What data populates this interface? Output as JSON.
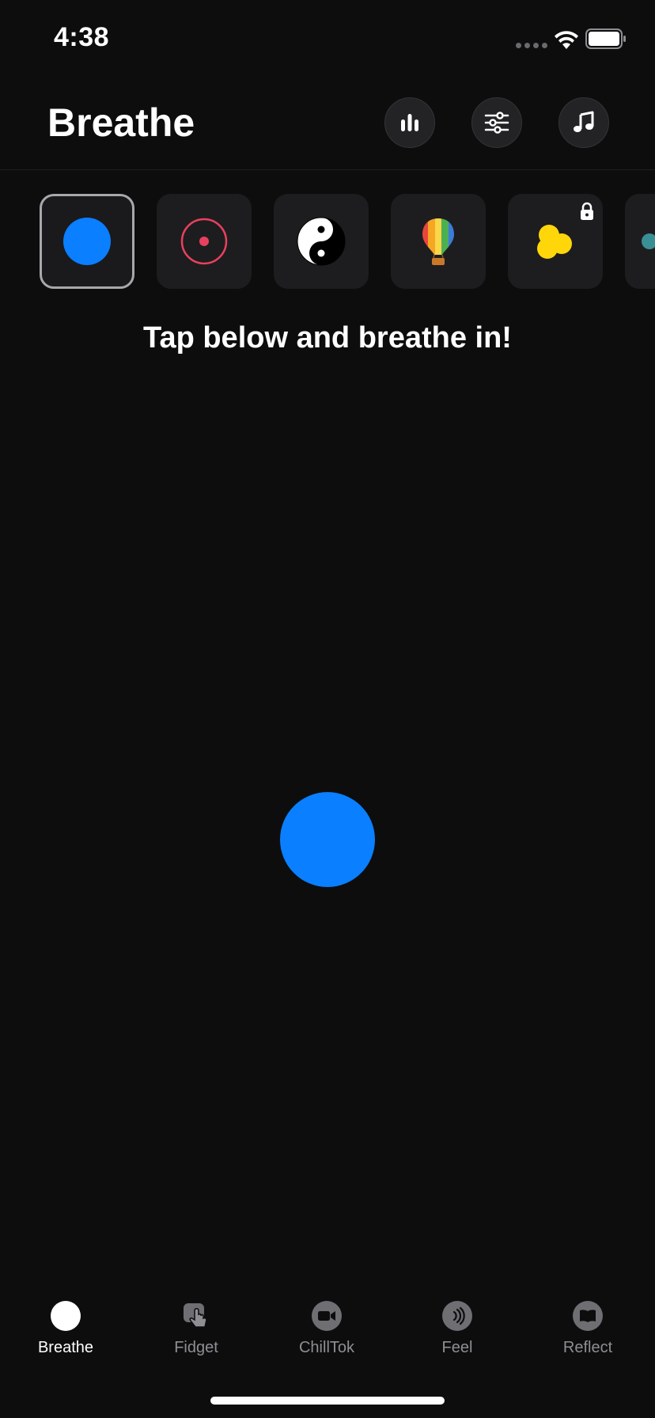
{
  "status_bar": {
    "time": "4:38",
    "icons": [
      "signal-icon",
      "wifi-icon",
      "battery-icon"
    ]
  },
  "header": {
    "title": "Breathe",
    "buttons": [
      "bar-chart-icon",
      "sliders-icon",
      "music-note-icon"
    ]
  },
  "themes": [
    {
      "icon": "blue-circle-icon",
      "selected": true,
      "locked": false
    },
    {
      "icon": "target-ring-icon",
      "selected": false,
      "locked": false
    },
    {
      "icon": "yin-yang-icon",
      "selected": false,
      "locked": false
    },
    {
      "icon": "hot-air-balloon-icon",
      "selected": false,
      "locked": false
    },
    {
      "icon": "yellow-blob-icon",
      "selected": false,
      "locked": true
    }
  ],
  "instruction": "Tap below and breathe in!",
  "colors": {
    "accent": "#0a7fff",
    "background": "#0d0d0e",
    "tab_inactive": "#8e8e93",
    "target_ring": "#e9405f",
    "blob": "#ffd60a"
  },
  "tabs": [
    {
      "label": "Breathe",
      "icon": "breathe-dot-icon",
      "active": true
    },
    {
      "label": "Fidget",
      "icon": "fidget-hand-icon",
      "active": false
    },
    {
      "label": "ChillTok",
      "icon": "video-camera-icon",
      "active": false
    },
    {
      "label": "Feel",
      "icon": "sound-waves-icon",
      "active": false
    },
    {
      "label": "Reflect",
      "icon": "book-icon",
      "active": false
    }
  ]
}
